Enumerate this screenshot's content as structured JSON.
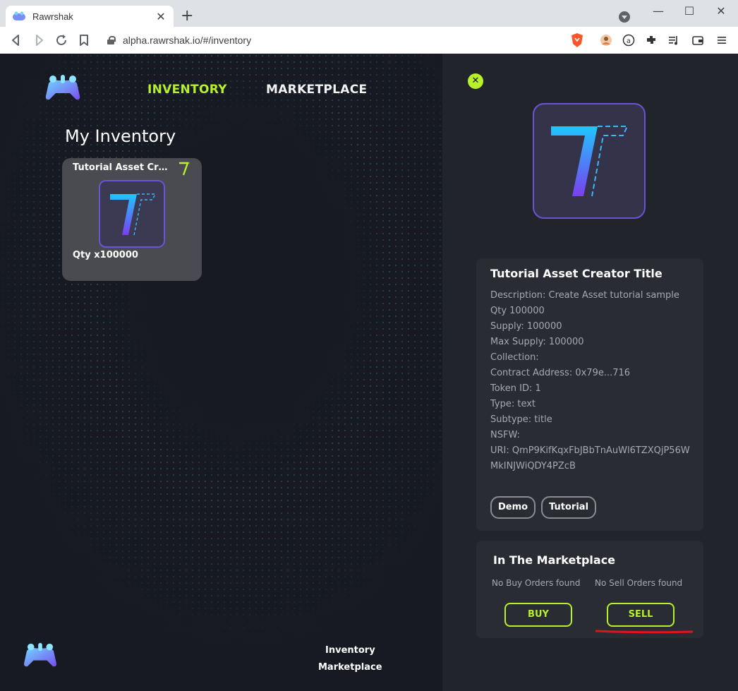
{
  "browser": {
    "tab_title": "Rawrshak",
    "tab_close": "✕",
    "new_tab": "+",
    "url": "alpha.rawrshak.io/#/inventory",
    "window_controls": [
      "—",
      "☐",
      "✕"
    ],
    "nav_icons": [
      "back-icon",
      "forward-icon",
      "reload-icon",
      "bookmark-icon"
    ],
    "extension_icons": [
      "profile-avatar-icon",
      "account-icon",
      "extensions-icon",
      "media-icon",
      "wallet-icon",
      "menu-icon"
    ]
  },
  "header": {
    "nav": {
      "inventory": "INVENTORY",
      "marketplace": "MARKETPLACE"
    },
    "active_color": "#b8f12b"
  },
  "inventory": {
    "title": "My Inventory",
    "cards": [
      {
        "title": "Tutorial Asset Cre…",
        "qty": "Qty x100000"
      }
    ]
  },
  "detail": {
    "close": "✕",
    "title": "Tutorial Asset Creator Title",
    "lines": [
      "Description: Create Asset tutorial sample",
      "Qty 100000",
      "Supply: 100000",
      "Max Supply: 100000",
      "Collection:",
      "Contract Address: 0x79e...716",
      "Token ID: 1",
      "Type: text",
      "Subtype: title",
      "NSFW:",
      "URI: QmP9KifKqxFbJBbTnAuWl6TZXQjP56WMkINJWiQDY4PZcB"
    ],
    "tags": [
      "Demo",
      "Tutorial"
    ]
  },
  "marketplace": {
    "title": "In The Marketplace",
    "buy_status": "No Buy Orders found",
    "sell_status": "No Sell Orders found",
    "buy_label": "BUY",
    "sell_label": "SELL"
  },
  "footer": {
    "links": [
      "Inventory",
      "Marketplace"
    ]
  },
  "colors": {
    "accent": "#b8f12b",
    "thumb_border": "#6b52d6",
    "annotation_red": "#e0141a"
  }
}
